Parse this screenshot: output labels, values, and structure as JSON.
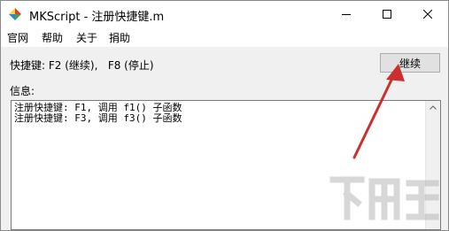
{
  "window": {
    "title": "MKScript - 注册快捷键.m"
  },
  "menu": {
    "items": [
      "官网",
      "帮助",
      "关于",
      "捐助"
    ]
  },
  "hotkeys": {
    "label": "快捷键: F2 (继续),   F8 (停止)"
  },
  "buttons": {
    "continue_label": "继续"
  },
  "info": {
    "label": "信息:",
    "lines": [
      "注册快捷键: F1, 调用 f1() 子函数",
      "注册快捷键: F3, 调用 f3() 子函数"
    ]
  },
  "icons": [
    "app-icon",
    "minimize-icon",
    "maximize-icon",
    "close-icon",
    "scroll-up-icon",
    "annotation-arrow-icon"
  ],
  "colors": {
    "arrow": "#cc2f2f",
    "client_bg": "#f0f0f0",
    "button_bg": "#e1e1e1"
  },
  "watermark": {
    "text": "下载吧"
  }
}
